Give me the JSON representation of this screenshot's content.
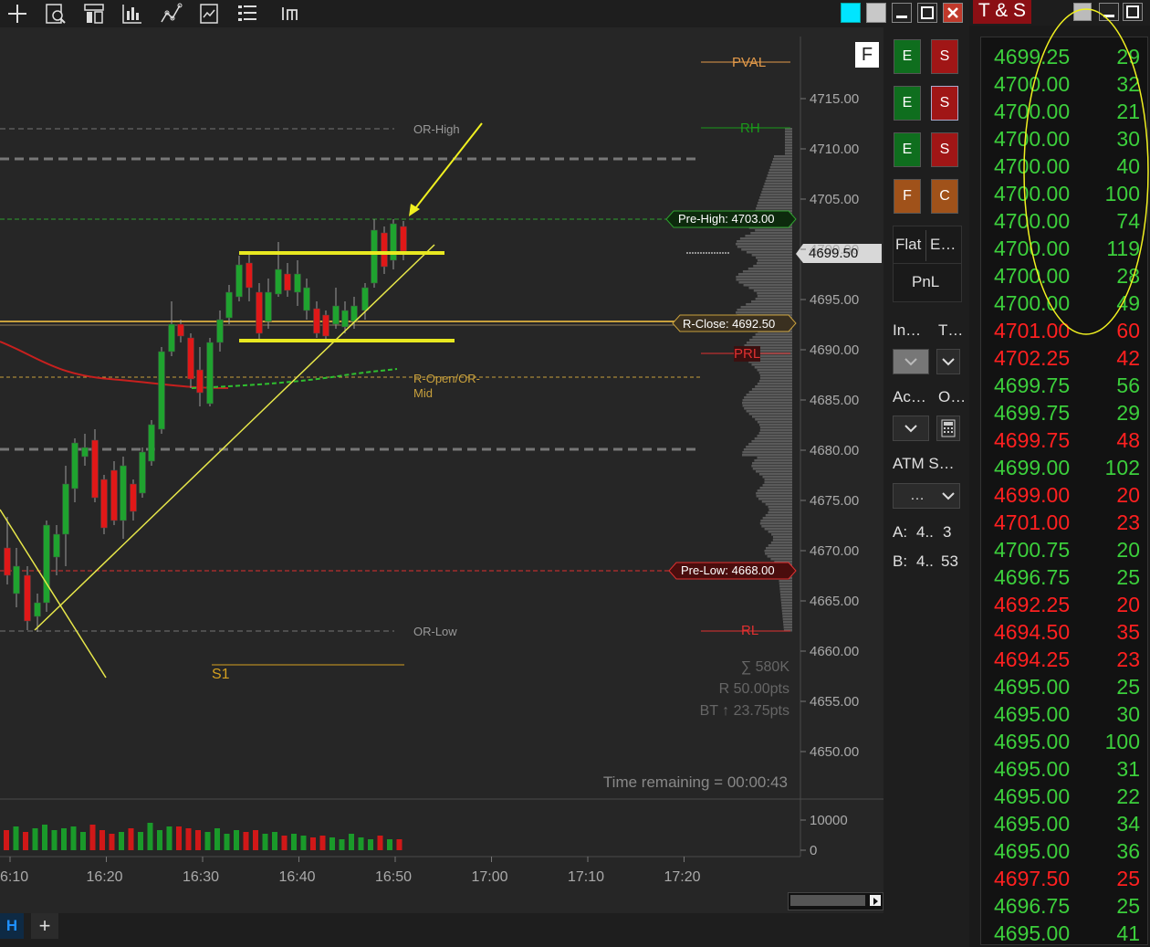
{
  "toolbar": {
    "icons": [
      "plus-icon",
      "chart-search-icon",
      "bar-properties-icon",
      "chart-style-icon",
      "drawing-tool-icon",
      "strategy-icon",
      "indicator-list-icon",
      "template-icon"
    ]
  },
  "chart": {
    "price_axis": [
      "4715.00",
      "4710.00",
      "4705.00",
      "4700.00",
      "4695.00",
      "4690.00",
      "4685.00",
      "4680.00",
      "4675.00",
      "4670.00",
      "4665.00",
      "4660.00",
      "4655.00",
      "4650.00"
    ],
    "time_axis": [
      "6:10",
      "16:20",
      "16:30",
      "16:40",
      "16:50",
      "17:00",
      "17:10",
      "17:20"
    ],
    "volume_axis": [
      "10000",
      "0"
    ],
    "last_price": "4699.50",
    "f_button": "F",
    "levels": {
      "pval": "PVAL",
      "rh": "RH",
      "pre_high": "Pre-High: 4703.00",
      "r_close": "R-Close: 4692.50",
      "prl": "PRL",
      "pre_low": "Pre-Low: 4668.00",
      "rl": "RL",
      "or_high": "OR-High",
      "or_low": "OR-Low",
      "r_open": "R-Open/OR-",
      "mid": "Mid",
      "s1": "S1"
    },
    "stats": {
      "volume_sum": "∑ 580K",
      "range": "R 50.00pts",
      "bt": "BT ↑ 23.75pts",
      "time_remaining": "Time remaining = 00:00:43"
    }
  },
  "side_panel": {
    "buy_labels": [
      "E",
      "E",
      "E"
    ],
    "sell_labels": [
      "S",
      "S",
      "S"
    ],
    "rev_label": "F",
    "close_label": "C",
    "flat": "Flat",
    "exit": "E…",
    "pnl": "PnL",
    "instrument_label": "In…",
    "tif_label": "T…",
    "account_label": "Ac…",
    "oco_label": "O…",
    "atm_label": "ATM S…",
    "atm_value": "…",
    "ask_label": "A:",
    "ask_price": "4..",
    "ask_size": "3",
    "bid_label": "B:",
    "bid_price": "4..",
    "bid_size": "53"
  },
  "bottom": {
    "tab_label": "H",
    "add_tab": "+"
  },
  "time_and_sales": {
    "title": "T & S",
    "colors": {
      "up": "#3ccf3c",
      "down": "#ff2020"
    },
    "rows": [
      {
        "price": "4699.25",
        "size": "29",
        "side": "up"
      },
      {
        "price": "4700.00",
        "size": "32",
        "side": "up"
      },
      {
        "price": "4700.00",
        "size": "21",
        "side": "up"
      },
      {
        "price": "4700.00",
        "size": "30",
        "side": "up"
      },
      {
        "price": "4700.00",
        "size": "40",
        "side": "up"
      },
      {
        "price": "4700.00",
        "size": "100",
        "side": "up"
      },
      {
        "price": "4700.00",
        "size": "74",
        "side": "up"
      },
      {
        "price": "4700.00",
        "size": "119",
        "side": "up"
      },
      {
        "price": "4700.00",
        "size": "28",
        "side": "up"
      },
      {
        "price": "4700.00",
        "size": "49",
        "side": "up"
      },
      {
        "price": "4701.00",
        "size": "60",
        "side": "down"
      },
      {
        "price": "4702.25",
        "size": "42",
        "side": "down"
      },
      {
        "price": "4699.75",
        "size": "56",
        "side": "up"
      },
      {
        "price": "4699.75",
        "size": "29",
        "side": "up"
      },
      {
        "price": "4699.75",
        "size": "48",
        "side": "down"
      },
      {
        "price": "4699.00",
        "size": "102",
        "side": "up"
      },
      {
        "price": "4699.00",
        "size": "20",
        "side": "down"
      },
      {
        "price": "4701.00",
        "size": "23",
        "side": "down"
      },
      {
        "price": "4700.75",
        "size": "20",
        "side": "up"
      },
      {
        "price": "4696.75",
        "size": "25",
        "side": "up"
      },
      {
        "price": "4692.25",
        "size": "20",
        "side": "down"
      },
      {
        "price": "4694.50",
        "size": "35",
        "side": "down"
      },
      {
        "price": "4694.25",
        "size": "23",
        "side": "down"
      },
      {
        "price": "4695.00",
        "size": "25",
        "side": "up"
      },
      {
        "price": "4695.00",
        "size": "30",
        "side": "up"
      },
      {
        "price": "4695.00",
        "size": "100",
        "side": "up"
      },
      {
        "price": "4695.00",
        "size": "31",
        "side": "up"
      },
      {
        "price": "4695.00",
        "size": "22",
        "side": "up"
      },
      {
        "price": "4695.00",
        "size": "34",
        "side": "up"
      },
      {
        "price": "4695.00",
        "size": "36",
        "side": "up"
      },
      {
        "price": "4697.50",
        "size": "25",
        "side": "down"
      },
      {
        "price": "4696.75",
        "size": "25",
        "side": "up"
      },
      {
        "price": "4695.00",
        "size": "41",
        "side": "up"
      }
    ]
  }
}
